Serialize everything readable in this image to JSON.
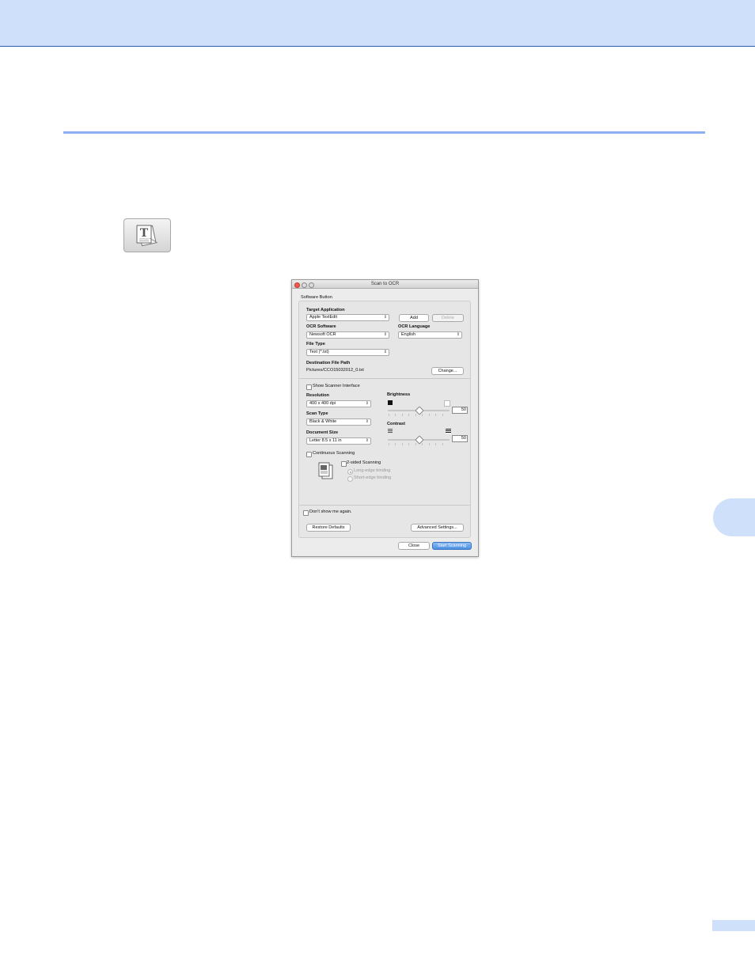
{
  "dialog": {
    "title": "Scan to OCR",
    "section_label": "Software Button",
    "target_application": {
      "label": "Target Application",
      "value": "Apple TextEdit"
    },
    "add_label": "Add",
    "delete_label": "Delete",
    "ocr_software": {
      "label": "OCR Software",
      "value": "Newsoft OCR"
    },
    "ocr_language": {
      "label": "OCR Language",
      "value": "English"
    },
    "file_type": {
      "label": "File Type",
      "value": "Text (*.txt)"
    },
    "destination": {
      "label": "Destination File Path",
      "value": "Pictures/CCO15032012_0.txt",
      "change_label": "Change..."
    },
    "show_scanner_interface": "Show Scanner Interface",
    "resolution": {
      "label": "Resolution",
      "value": "400 x 400 dpi"
    },
    "scan_type": {
      "label": "Scan Type",
      "value": "Black & White"
    },
    "document_size": {
      "label": "Document Size",
      "value": "Letter 8.5 x 11 in"
    },
    "brightness": {
      "label": "Brightness",
      "value": "50",
      "level": 0.5
    },
    "contrast": {
      "label": "Contrast",
      "value": "50",
      "level": 0.5
    },
    "continuous_scanning": "Continuous Scanning",
    "two_sided": {
      "label": "2-sided Scanning",
      "long_edge": "Long-edge binding",
      "short_edge": "Short-edge binding"
    },
    "dont_show": "Don't show me again.",
    "restore_defaults": "Restore Defaults",
    "advanced_settings": "Advanced Settings...",
    "close_label": "Close",
    "start_scanning_label": "Start Scanning"
  }
}
